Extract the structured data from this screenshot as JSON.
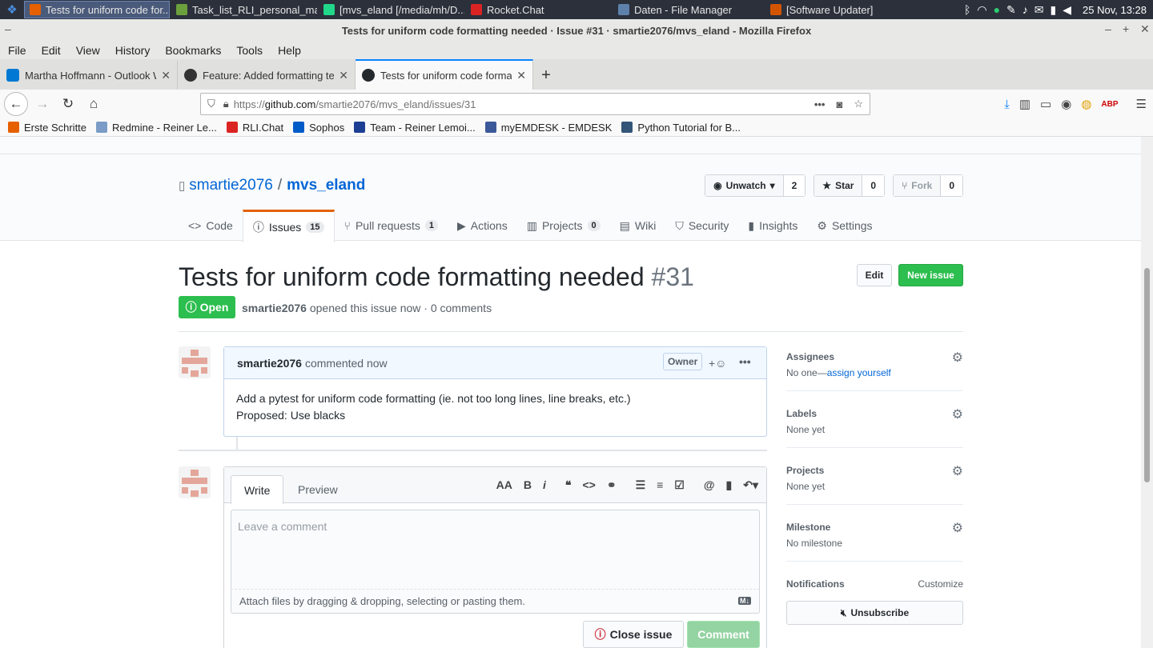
{
  "taskbar": {
    "items": [
      {
        "label": "Tests for uniform code for...",
        "color": "#e66000",
        "active": true
      },
      {
        "label": "Task_list_RLI_personal_ma...",
        "color": "#6ca03c",
        "active": false
      },
      {
        "label": "[mvs_eland [/media/mh/D...",
        "color": "#21d789",
        "active": false
      },
      {
        "label": "Rocket.Chat",
        "color": "#db2323",
        "active": false
      },
      {
        "label": "Daten - File Manager",
        "color": "#5e81ac",
        "active": false
      },
      {
        "label": "[Software Updater]",
        "color": "#d35400",
        "active": false
      }
    ],
    "clock": "25 Nov, 13:28"
  },
  "window": {
    "title": "Tests for uniform code formatting needed · Issue #31 · smartie2076/mvs_eland - Mozilla Firefox"
  },
  "menu": [
    "File",
    "Edit",
    "View",
    "History",
    "Bookmarks",
    "Tools",
    "Help"
  ],
  "tabs": [
    {
      "title": "Martha Hoffmann - Outlook W",
      "color": "#0078d4",
      "active": false
    },
    {
      "title": "Feature: Added formatting te",
      "color": "#333333",
      "active": false
    },
    {
      "title": "Tests for uniform code format",
      "color": "#24292e",
      "active": true
    }
  ],
  "url": {
    "prefix": "https://",
    "domain": "github.com",
    "path": "/smartie2076/mvs_eland/issues/31"
  },
  "bookmarks": [
    {
      "label": "Erste Schritte",
      "color": "#e66000"
    },
    {
      "label": "Redmine - Reiner Le...",
      "color": "#7a9cc6"
    },
    {
      "label": "RLI.Chat",
      "color": "#db2323"
    },
    {
      "label": "Sophos",
      "color": "#005bc8"
    },
    {
      "label": "Team - Reiner Lemoi...",
      "color": "#1c3f94"
    },
    {
      "label": "myEMDESK - EMDESK",
      "color": "#3b5998"
    },
    {
      "label": "Python Tutorial for B...",
      "color": "#335577"
    }
  ],
  "repo": {
    "owner": "smartie2076",
    "sep": "/",
    "name": "mvs_eland",
    "unwatch_label": "Unwatch",
    "watch_count": "2",
    "star_label": "Star",
    "star_count": "0",
    "fork_label": "Fork",
    "fork_count": "0"
  },
  "reponav": [
    {
      "label": "Code",
      "icon": "<>",
      "count": ""
    },
    {
      "label": "Issues",
      "icon": "ⓘ",
      "count": "15"
    },
    {
      "label": "Pull requests",
      "icon": "⑂",
      "count": "1"
    },
    {
      "label": "Actions",
      "icon": "▶",
      "count": ""
    },
    {
      "label": "Projects",
      "icon": "▥",
      "count": "0"
    },
    {
      "label": "Wiki",
      "icon": "▤",
      "count": ""
    },
    {
      "label": "Security",
      "icon": "⛉",
      "count": ""
    },
    {
      "label": "Insights",
      "icon": "▮",
      "count": ""
    },
    {
      "label": "Settings",
      "icon": "⚙",
      "count": ""
    }
  ],
  "issue": {
    "title": "Tests for uniform code formatting needed",
    "number": "#31",
    "edit_label": "Edit",
    "new_label": "New issue",
    "state": "Open",
    "author": "smartie2076",
    "meta_text": "opened this issue now · 0 comments"
  },
  "comment": {
    "author": "smartie2076",
    "action": "commented now",
    "badge": "Owner",
    "line1": "Add a pytest for uniform code formatting (ie. not too long lines, line breaks, etc.)",
    "line2": "Proposed: Use blacks"
  },
  "editor": {
    "write_tab": "Write",
    "preview_tab": "Preview",
    "placeholder": "Leave a comment",
    "attach_text": "Attach files by dragging & dropping, selecting or pasting them.",
    "md_badge": "M↓",
    "close_label": "Close issue",
    "comment_label": "Comment"
  },
  "sidebar": {
    "assignees": {
      "head": "Assignees",
      "value": "No one—",
      "link": "assign yourself"
    },
    "labels": {
      "head": "Labels",
      "value": "None yet"
    },
    "projects": {
      "head": "Projects",
      "value": "None yet"
    },
    "milestone": {
      "head": "Milestone",
      "value": "No milestone"
    },
    "notifications": {
      "head": "Notifications",
      "customize": "Customize",
      "unsubscribe": "Unsubscribe"
    }
  }
}
